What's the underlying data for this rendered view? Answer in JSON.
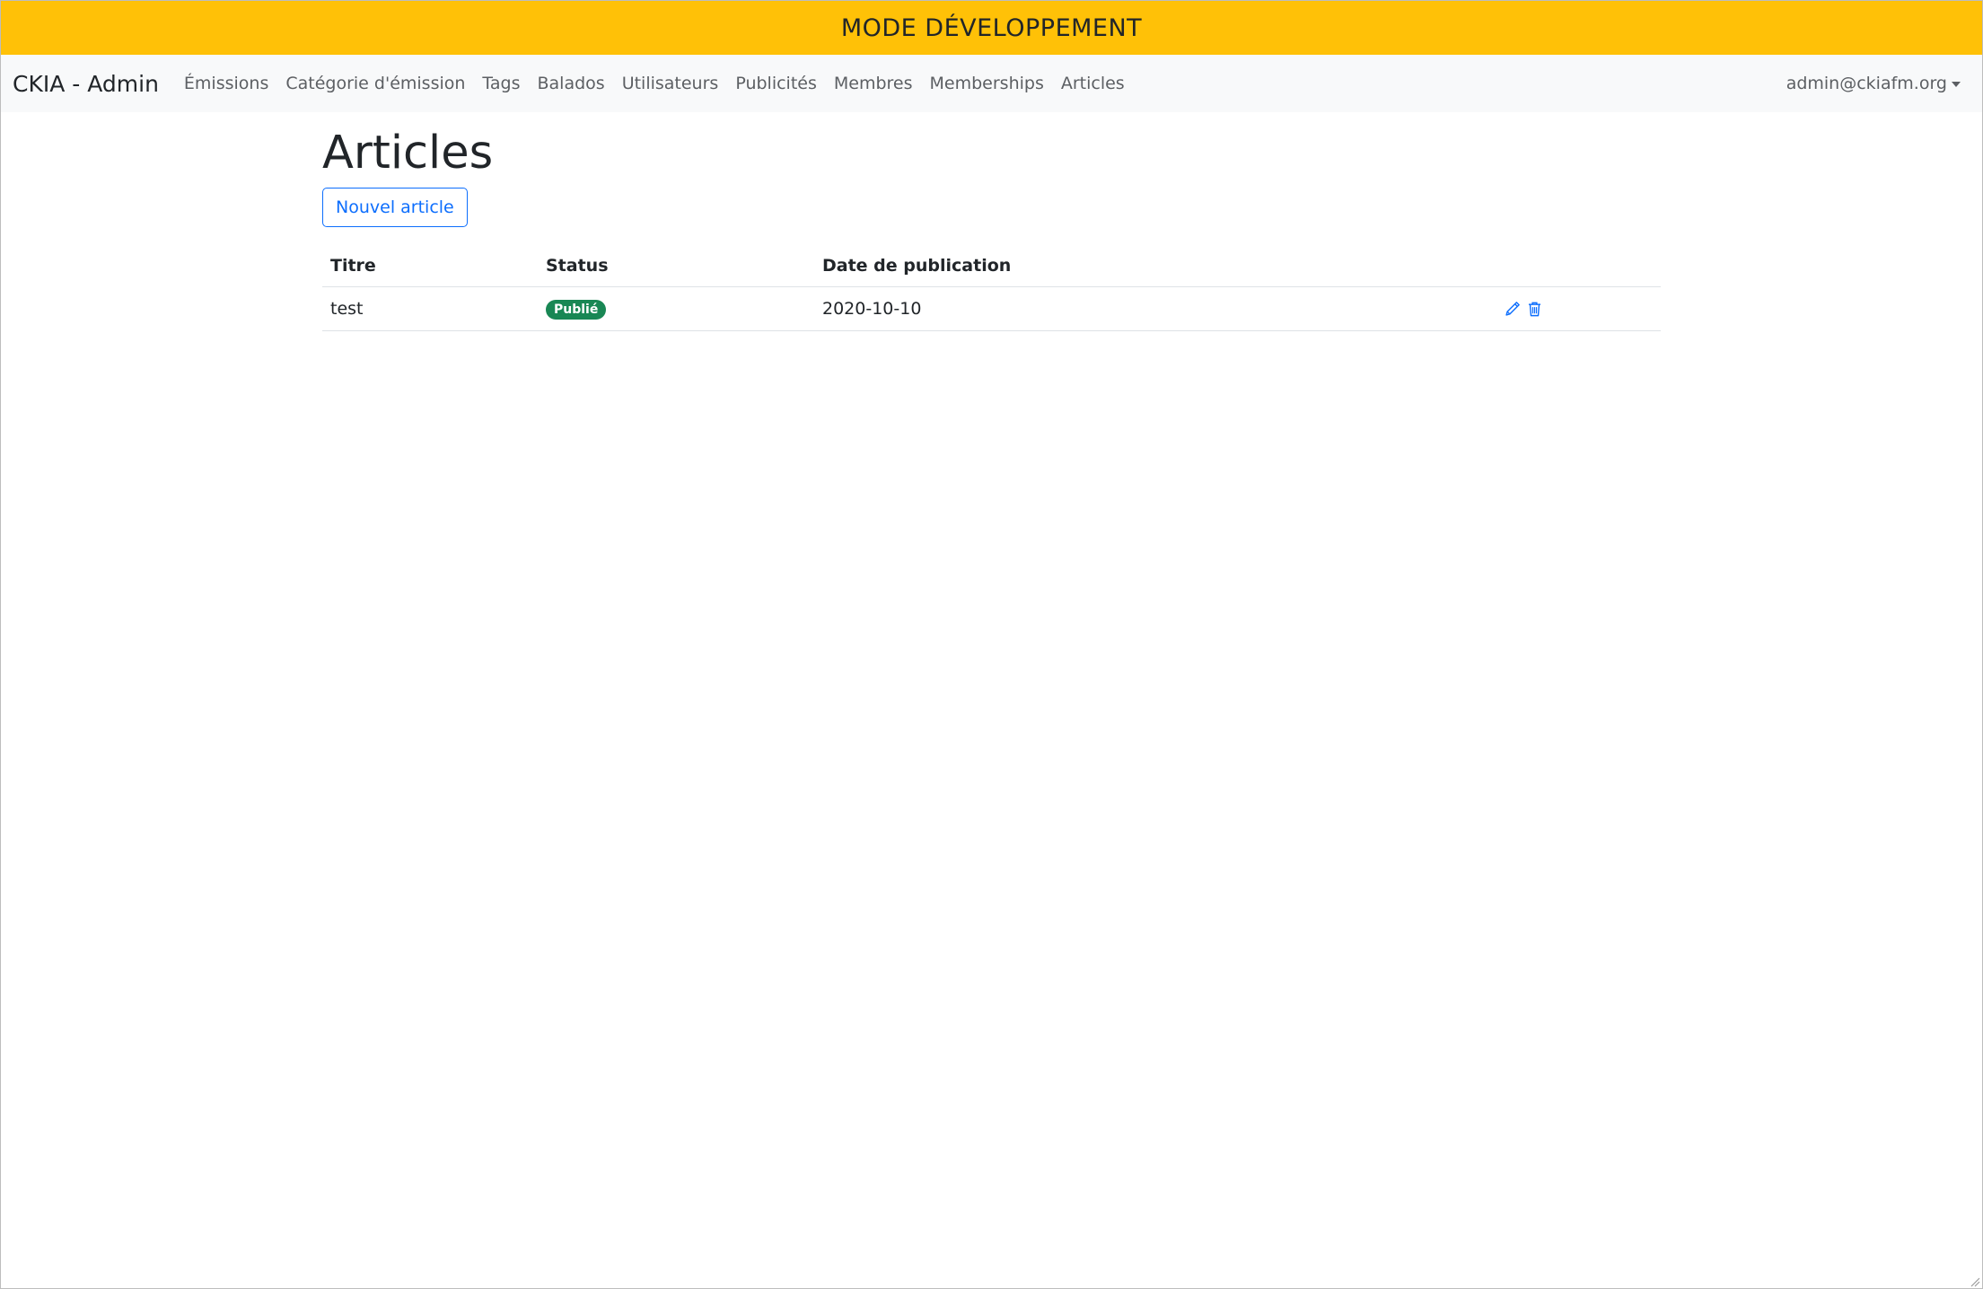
{
  "banner": {
    "text": "MODE DÉVELOPPEMENT",
    "color": "#ffc107"
  },
  "navbar": {
    "brand": "CKIA - Admin",
    "links": [
      {
        "label": "Émissions"
      },
      {
        "label": "Catégorie d'émission"
      },
      {
        "label": "Tags"
      },
      {
        "label": "Balados"
      },
      {
        "label": "Utilisateurs"
      },
      {
        "label": "Publicités"
      },
      {
        "label": "Membres"
      },
      {
        "label": "Memberships"
      },
      {
        "label": "Articles"
      }
    ],
    "user_menu": "admin@ckiafm.org"
  },
  "main": {
    "title": "Articles",
    "new_button": "Nouvel article",
    "table": {
      "headers": [
        "Titre",
        "Status",
        "Date de publication",
        ""
      ],
      "rows": [
        {
          "title": "test",
          "status": "Publié",
          "status_color": "#198754",
          "date": "2020-10-10",
          "actions": [
            "pencil-icon",
            "trash-icon"
          ]
        }
      ]
    }
  },
  "accent_color": "#0d6efd"
}
